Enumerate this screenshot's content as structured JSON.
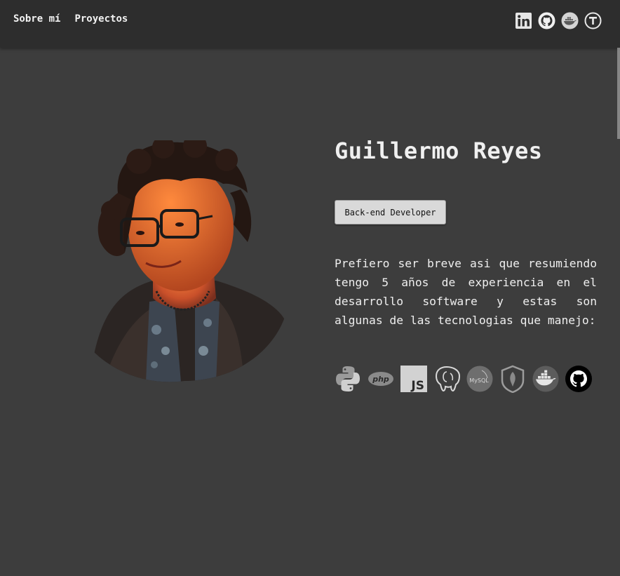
{
  "nav": {
    "about_label": "Sobre mí",
    "projects_label": "Proyectos"
  },
  "social": [
    {
      "icon": "linkedin-icon"
    },
    {
      "icon": "github-icon"
    },
    {
      "icon": "docker-icon"
    },
    {
      "icon": "t-logo-icon"
    }
  ],
  "profile": {
    "name": "Guillermo Reyes",
    "role": "Back-end Developer",
    "bio": "Prefiero ser breve asi que resumiendo tengo 5 años de experiencia en el desarrollo software y estas son algunas de las tecnologias que manejo:"
  },
  "tech": {
    "icons": [
      "python-icon",
      "php-icon",
      "javascript-icon",
      "postgresql-icon",
      "mysql-icon",
      "mongodb-icon",
      "docker-icon",
      "github-icon"
    ],
    "php_text": "php",
    "js_text": "JS",
    "mysql_text": "MySQL"
  },
  "colors": {
    "background": "#3d3d3d",
    "topbar": "#2d2d2d",
    "text": "#ececec",
    "button": "#d9d9d9"
  }
}
